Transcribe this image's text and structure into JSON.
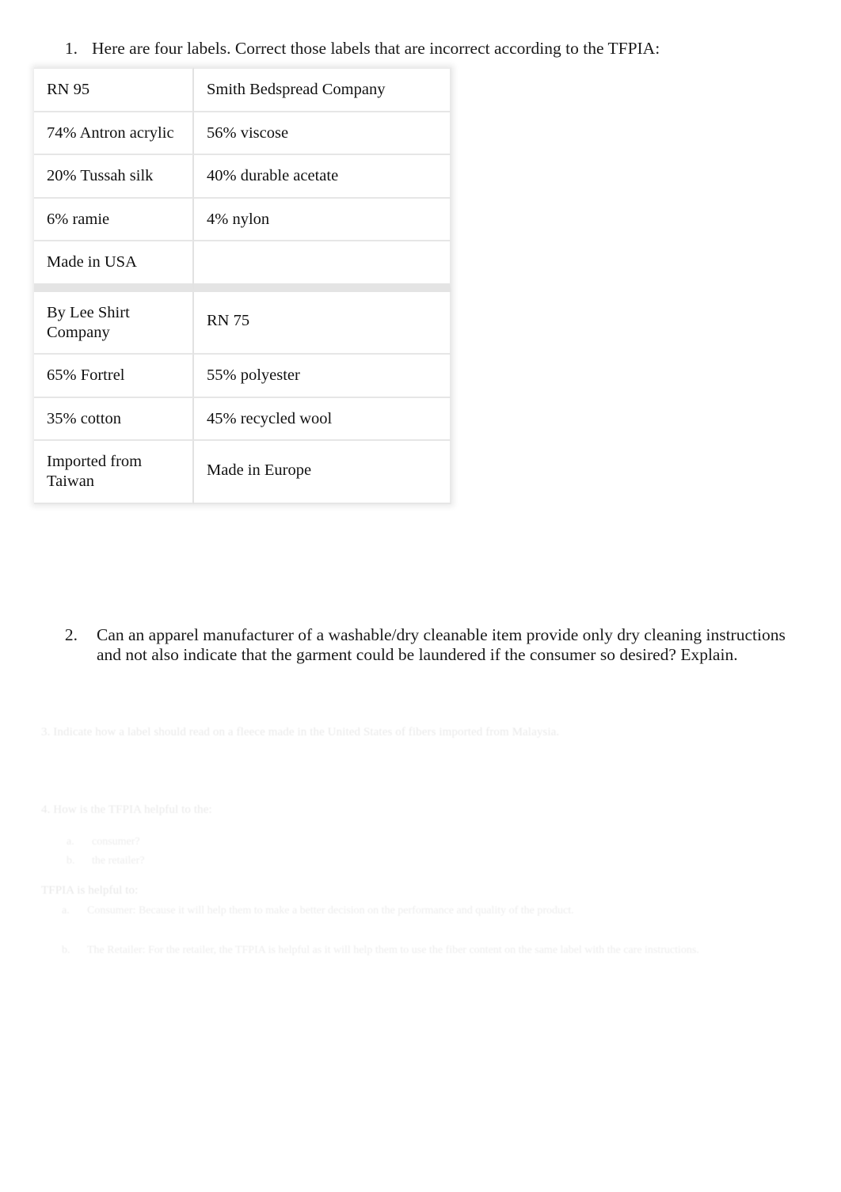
{
  "document": {
    "questions": [
      {
        "number": "1.",
        "text": "Here are four labels. Correct those labels that are incorrect according to the TFPIA:"
      },
      {
        "number": "2.",
        "text": "Can an apparel manufacturer of a washable/dry cleanable item provide only dry cleaning instructions and not also indicate that the garment could be laundered if the consumer so desired? Explain."
      }
    ],
    "labels_table": {
      "columns": [
        "label-left",
        "label-right"
      ],
      "rows": [
        {
          "left": "RN 95",
          "right": "Smith Bedspread Company",
          "group_break": false,
          "mid_align": false
        },
        {
          "left": "74% Antron acrylic",
          "right": "56% viscose",
          "group_break": false,
          "mid_align": false
        },
        {
          "left": "20% Tussah silk",
          "right": "40% durable acetate",
          "group_break": false,
          "mid_align": false
        },
        {
          "left": "6% ramie",
          "right": "4% nylon",
          "group_break": false,
          "mid_align": false
        },
        {
          "left": "Made in USA",
          "right": "",
          "group_break": true,
          "mid_align": false
        },
        {
          "left": "By Lee Shirt Company",
          "right": "RN 75",
          "group_break": false,
          "mid_align": true
        },
        {
          "left": "65% Fortrel",
          "right": "55% polyester",
          "group_break": false,
          "mid_align": false
        },
        {
          "left": "35% cotton",
          "right": "45% recycled wool",
          "group_break": false,
          "mid_align": false
        },
        {
          "left": "Imported from Taiwan",
          "right": "Made in Europe",
          "group_break": false,
          "mid_align": true
        }
      ]
    },
    "faded_content": {
      "question3": "3. Indicate how a label should read on a fleece made in the United States of fibers imported from Malaysia.",
      "question4": "4. How is the TFPIA helpful to the:",
      "question4_sub": [
        {
          "letter": "a.",
          "text": "consumer?"
        },
        {
          "letter": "b.",
          "text": "the retailer?"
        }
      ],
      "answer_heading": "TFPIA is helpful to:",
      "answers": [
        {
          "letter": "a.",
          "text": "Consumer: Because it will help them to make a better decision on the performance and quality of the product."
        },
        {
          "letter": "b.",
          "text": "The Retailer: For the retailer, the TFPIA is helpful as it will help them to use the fiber content on the same label with the care instructions."
        }
      ]
    }
  }
}
